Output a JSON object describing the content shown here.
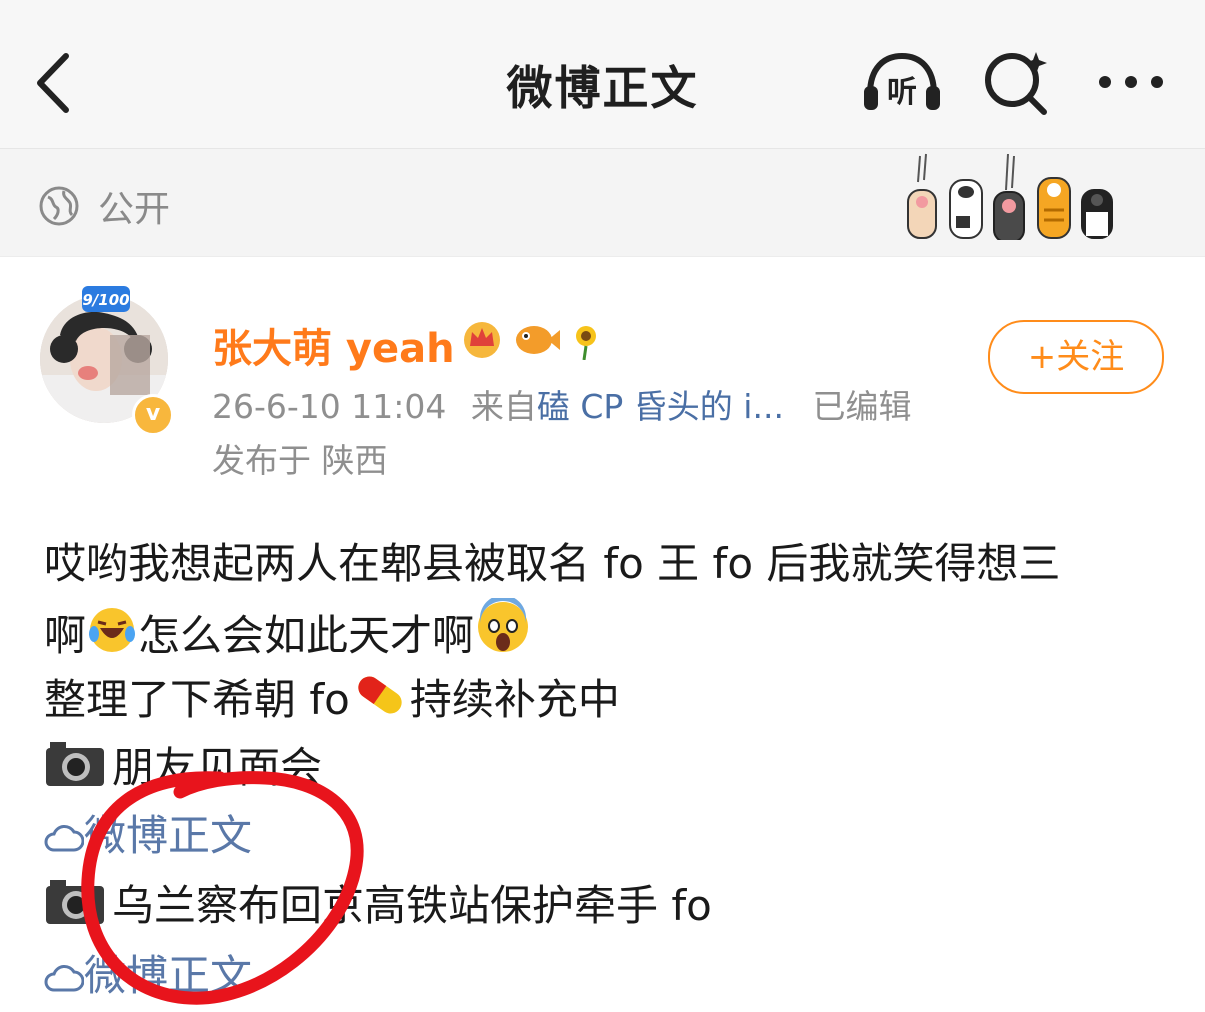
{
  "nav": {
    "title": "微博正文",
    "listen_label": "听"
  },
  "visibility": {
    "label": "公开"
  },
  "author": {
    "name": "张大萌 yeah",
    "avatar_badge": "9/100",
    "verified_mark": "v",
    "timestamp": "26-6-10 11:04",
    "source_prefix": "来自",
    "source": "磕 CP 昏头的 i...",
    "edited": "已编辑",
    "location": "发布于 陕西",
    "follow_label": "+关注"
  },
  "post": {
    "line1": "哎哟我想起两人在郫县被取名 fo 王 fo 后我就笑得想三",
    "line2a": "啊",
    "line2b": "怎么会如此天才啊",
    "line3a": "整理了下希朝 fo",
    "line3b": "持续补充中",
    "item1": "朋友见面会",
    "link1": "微博正文",
    "item2": "乌兰察布回京高铁站保护牵手 fo",
    "link2": "微博正文"
  },
  "colors": {
    "accent": "#ff8c1a",
    "link": "#5a78a8",
    "annotation": "#e8141c"
  }
}
